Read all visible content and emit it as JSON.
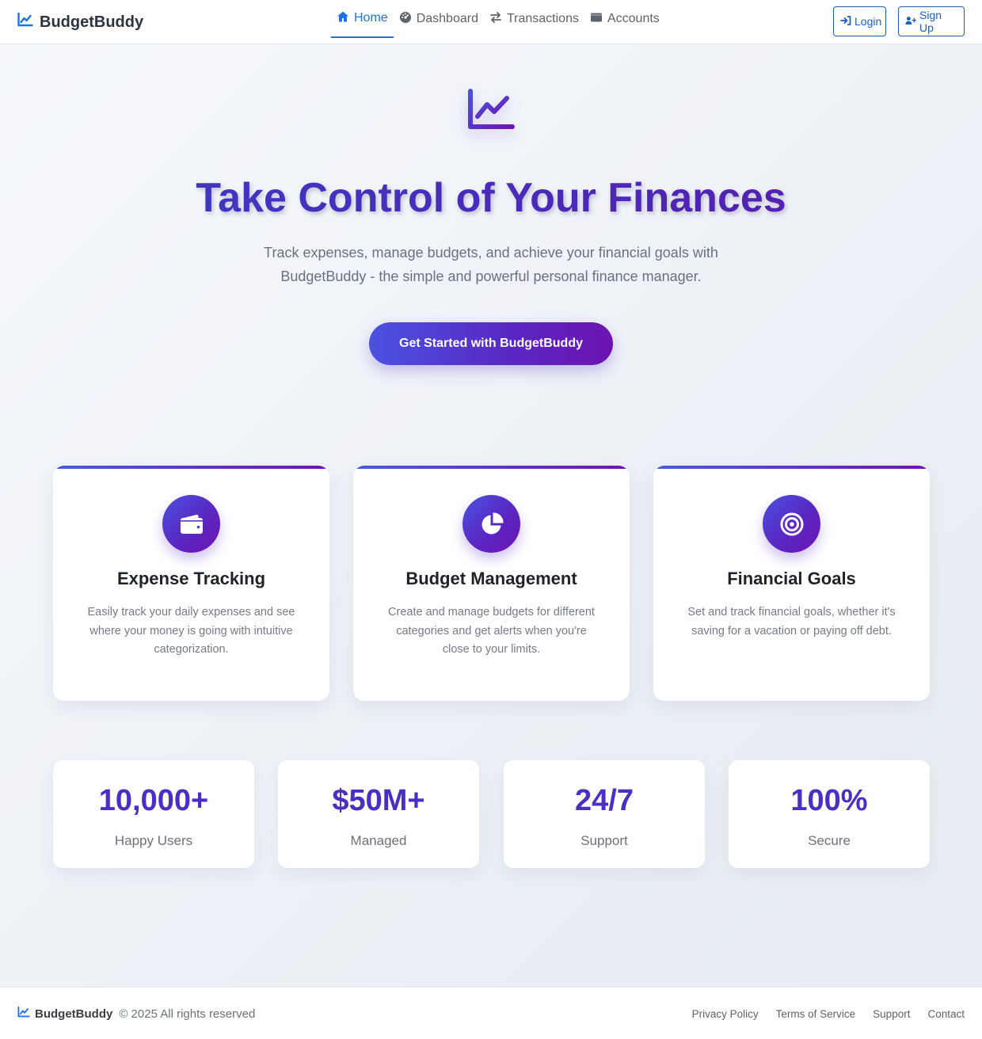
{
  "colors": {
    "primary": "#1a73e8",
    "gradient_start": "#4a52e0",
    "gradient_end": "#6d14b0",
    "stat_value": "#4a2fc4"
  },
  "nav": {
    "brand": "BudgetBuddy",
    "brand_icon": "chart-line-icon",
    "links": [
      {
        "label": "Home",
        "icon": "home-icon",
        "active": true
      },
      {
        "label": "Dashboard",
        "icon": "dashboard-icon",
        "active": false
      },
      {
        "label": "Transactions",
        "icon": "exchange-icon",
        "active": false
      },
      {
        "label": "Accounts",
        "icon": "wallet-icon",
        "active": false
      }
    ],
    "login_label": "Login",
    "signup_label": "Sign Up"
  },
  "hero": {
    "icon": "chart-line-icon",
    "title": "Take Control of Your Finances",
    "subtitle": "Track expenses, manage budgets, and achieve your financial goals with BudgetBuddy - the simple and powerful personal finance manager.",
    "cta_label": "Get Started with BudgetBuddy"
  },
  "features": [
    {
      "icon": "wallet-icon",
      "title": "Expense Tracking",
      "text": "Easily track your daily expenses and see where your money is going with intuitive categorization."
    },
    {
      "icon": "pie-chart-icon",
      "title": "Budget Management",
      "text": "Create and manage budgets for different categories and get alerts when you're close to your limits."
    },
    {
      "icon": "target-icon",
      "title": "Financial Goals",
      "text": "Set and track financial goals, whether it's saving for a vacation or paying off debt."
    }
  ],
  "stats": [
    {
      "value": "10,000+",
      "label": "Happy Users"
    },
    {
      "value": "$50M+",
      "label": "Managed"
    },
    {
      "value": "24/7",
      "label": "Support"
    },
    {
      "value": "100%",
      "label": "Secure"
    }
  ],
  "footer": {
    "brand": "BudgetBuddy",
    "copyright": "© 2025 All rights reserved",
    "links": [
      "Privacy Policy",
      "Terms of Service",
      "Support",
      "Contact"
    ]
  }
}
